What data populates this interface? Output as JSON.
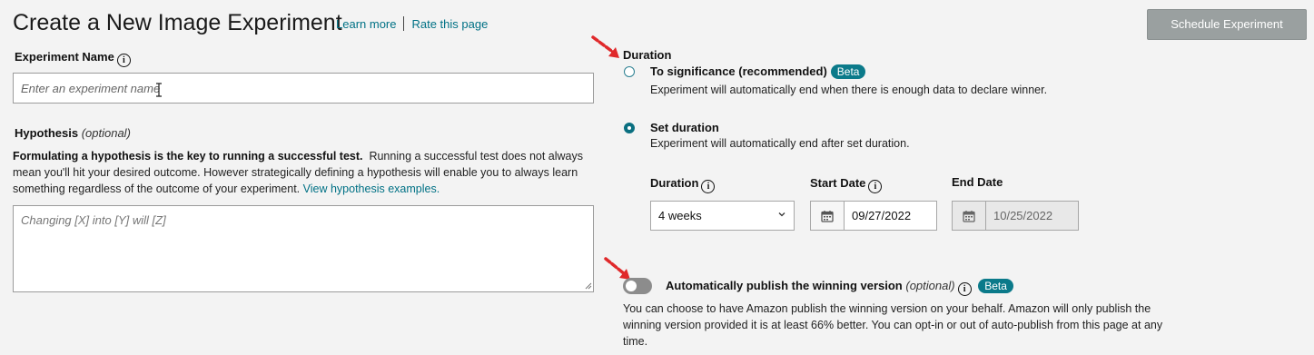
{
  "header": {
    "title": "Create a New Image Experiment",
    "learn_more": "Learn more",
    "rate_page": "Rate this page",
    "schedule_button": "Schedule Experiment"
  },
  "experiment_name": {
    "label": "Experiment Name",
    "placeholder": "Enter an experiment name"
  },
  "hypothesis": {
    "label": "Hypothesis",
    "optional": "(optional)",
    "intro_bold": "Formulating a hypothesis is the key to running a successful test.",
    "intro_rest": "Running a successful test does not always mean you'll hit your desired outcome. However strategically defining a hypothesis will enable you to always learn something regardless of the outcome of your experiment.",
    "examples_link": "View hypothesis examples.",
    "placeholder": "Changing [X] into [Y] will [Z]"
  },
  "duration": {
    "heading": "Duration",
    "option_significance": {
      "label": "To significance (recommended)",
      "badge": "Beta",
      "description": "Experiment will automatically end when there is enough data to declare winner.",
      "selected": false
    },
    "option_set": {
      "label": "Set duration",
      "description": "Experiment will automatically end after set duration.",
      "selected": true
    },
    "duration_label": "Duration",
    "duration_value": "4 weeks",
    "start_date_label": "Start Date",
    "start_date_value": "09/27/2022",
    "end_date_label": "End Date",
    "end_date_value": "10/25/2022"
  },
  "auto_publish": {
    "label": "Automatically publish the winning version",
    "optional": "(optional)",
    "badge": "Beta",
    "enabled": false,
    "description": "You can choose to have Amazon publish the winning version on your behalf. Amazon will only publish the winning version provided it is at least 66% better. You can opt-in or out of auto-publish from this page at any time."
  },
  "colors": {
    "accent": "#007185",
    "badge": "#0b7a8a",
    "button_disabled": "#9aa0a0",
    "annotation_arrow": "#e0292b"
  },
  "icons": {
    "info": "info-icon",
    "calendar": "calendar-icon",
    "chevron": "chevron-down-icon",
    "arrow": "red-arrow-annotation"
  }
}
